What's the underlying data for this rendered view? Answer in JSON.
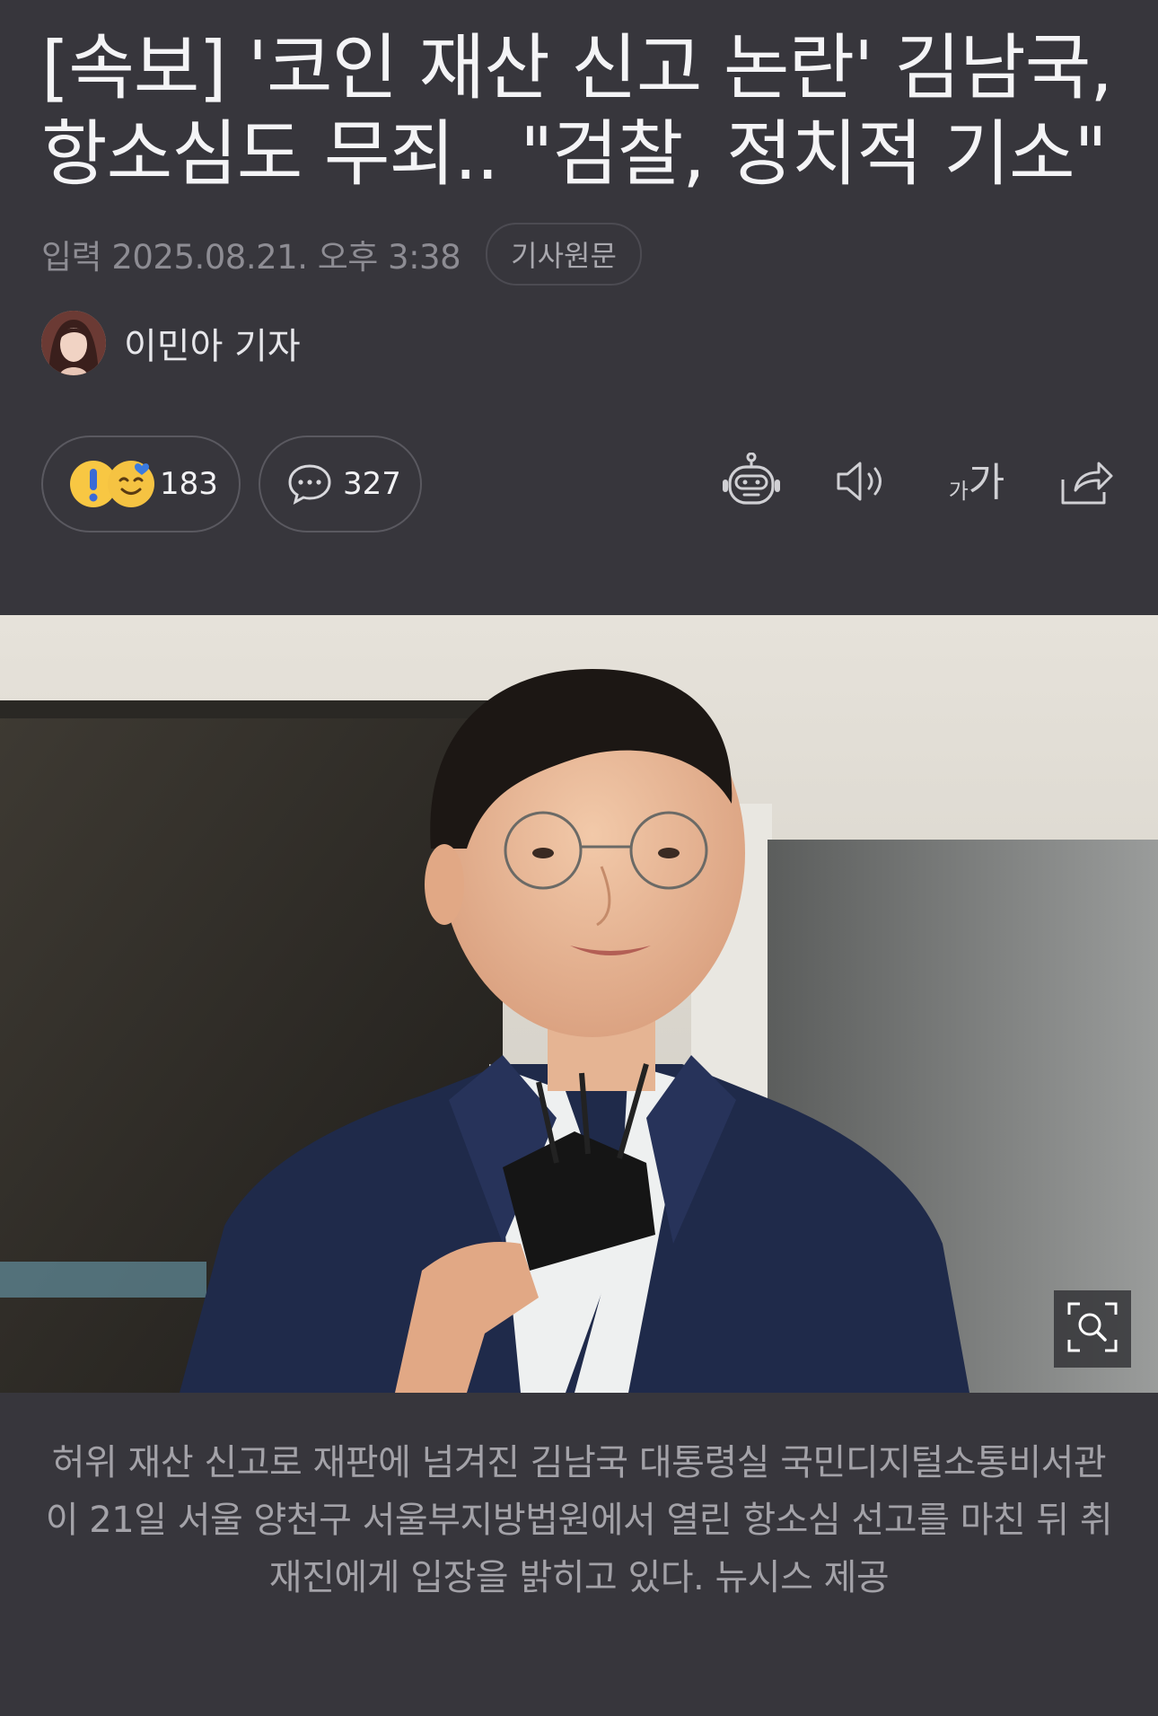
{
  "article": {
    "headline_line1": "[속보] '코인 재산 신고 논란' 김남국,",
    "headline_line2": "항소심도 무죄.. \"검찰, 정치적 기소\"",
    "published": "입력 2025.08.21. 오후 3:38",
    "original_label": "기사원문",
    "reporter": "이민아 기자"
  },
  "actions": {
    "reactions_count": "183",
    "comments_count": "327",
    "font_size_label_small": "가",
    "font_size_label_large": "가"
  },
  "icons": [
    "exclaim-emoji-icon",
    "smile-emoji-icon",
    "comment-icon",
    "robot-summary-icon",
    "speaker-icon",
    "font-size-icon",
    "share-icon",
    "zoom-icon"
  ],
  "photo": {
    "caption": "허위 재산 신고로 재판에 넘겨진 김남국 대통령실 국민디지털소통비서관이 21일 서울 양천구 서울부지방법원에서 열린 항소심 선고를 마친 뒤 취재진에게 입장을 밝히고 있다. 뉴시스 제공"
  },
  "colors": {
    "background": "#37363c",
    "text": "#f2f2f4",
    "muted": "#8d8c93",
    "emoji": "#f8c743"
  }
}
